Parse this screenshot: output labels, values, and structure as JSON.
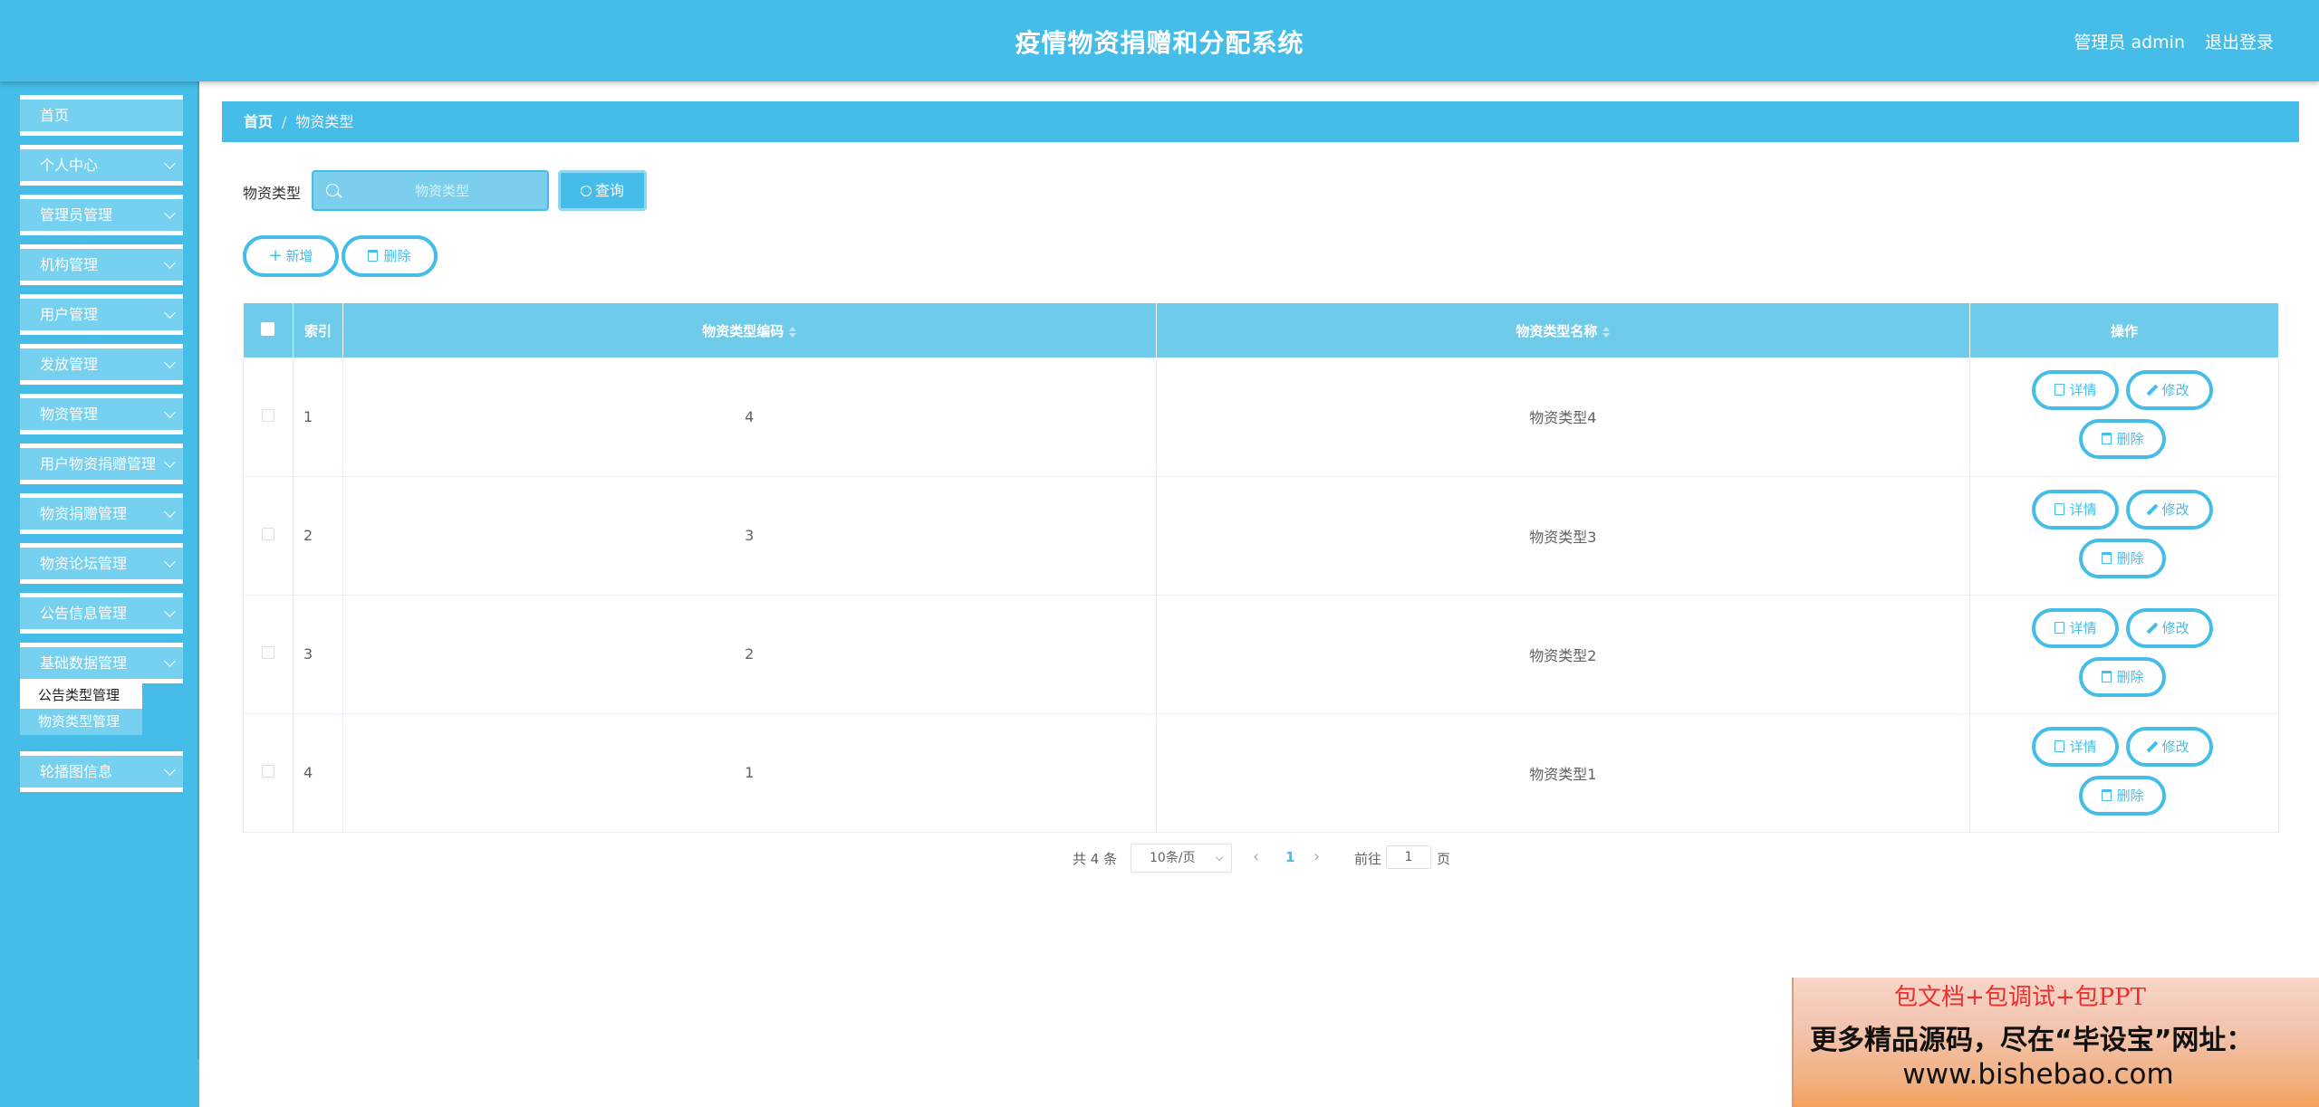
{
  "header": {
    "title": "疫情物资捐赠和分配系统",
    "user_label": "管理员 admin",
    "logout_label": "退出登录"
  },
  "sidebar": {
    "items": [
      {
        "label": "首页",
        "has_arrow": false
      },
      {
        "label": "个人中心",
        "has_arrow": true
      },
      {
        "label": "管理员管理",
        "has_arrow": true
      },
      {
        "label": "机构管理",
        "has_arrow": true
      },
      {
        "label": "用户管理",
        "has_arrow": true
      },
      {
        "label": "发放管理",
        "has_arrow": true
      },
      {
        "label": "物资管理",
        "has_arrow": true
      },
      {
        "label": "用户物资捐赠管理",
        "has_arrow": true
      },
      {
        "label": "物资捐赠管理",
        "has_arrow": true
      },
      {
        "label": "物资论坛管理",
        "has_arrow": true
      },
      {
        "label": "公告信息管理",
        "has_arrow": true
      },
      {
        "label": "基础数据管理",
        "has_arrow": true
      },
      {
        "label": "轮播图信息",
        "has_arrow": true
      }
    ],
    "submenu": [
      {
        "label": "公告类型管理",
        "active": true
      },
      {
        "label": "物资类型管理",
        "active": false
      }
    ]
  },
  "breadcrumb": {
    "home": "首页",
    "separator": "/",
    "current": "物资类型"
  },
  "search": {
    "label": "物资类型",
    "placeholder": "物资类型",
    "value": "",
    "button_label": "查询"
  },
  "actions": {
    "add_label": "新增",
    "delete_label": "删除"
  },
  "table": {
    "columns": [
      "",
      "索引",
      "物资类型编码",
      "物资类型名称",
      "操作"
    ],
    "rows": [
      {
        "index": "1",
        "code": "4",
        "name": "物资类型4"
      },
      {
        "index": "2",
        "code": "3",
        "name": "物资类型3"
      },
      {
        "index": "3",
        "code": "2",
        "name": "物资类型2"
      },
      {
        "index": "4",
        "code": "1",
        "name": "物资类型1"
      }
    ],
    "op_labels": {
      "detail": "详情",
      "edit": "修改",
      "delete": "删除"
    }
  },
  "pagination": {
    "total_text": "共 4 条",
    "page_size": "10条/页",
    "prev": "‹",
    "current_page": "1",
    "next": "›",
    "goto_label": "前往",
    "goto_value": "1",
    "page_unit": "页"
  },
  "promo": {
    "line1": "包文档+包调试+包PPT",
    "line2": "更多精品源码，尽在“毕设宝”网址：",
    "line3": "www.bishebao.com"
  },
  "colors": {
    "primary": "#45bde8",
    "menu_bg": "#76d0ef",
    "table_header": "#6ecbea"
  }
}
